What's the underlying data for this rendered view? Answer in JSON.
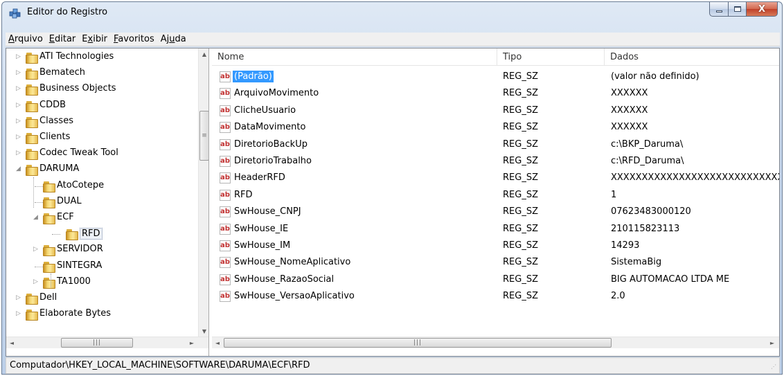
{
  "window": {
    "title": "Editor do Registro",
    "minimize_label": "",
    "maximize_label": "",
    "close_label": "X",
    "colors": {
      "selection": "#3399ff",
      "ab_icon": "#c03030"
    }
  },
  "menu": [
    {
      "pre": "",
      "key": "A",
      "post": "rquivo"
    },
    {
      "pre": "",
      "key": "E",
      "post": "ditar"
    },
    {
      "pre": "E",
      "key": "x",
      "post": "ibir"
    },
    {
      "pre": "",
      "key": "F",
      "post": "avoritos"
    },
    {
      "pre": "Aj",
      "key": "u",
      "post": "da"
    }
  ],
  "tree": {
    "items": [
      {
        "label": "ATI Technologies"
      },
      {
        "label": "Bematech"
      },
      {
        "label": "Business Objects"
      },
      {
        "label": "CDDB"
      },
      {
        "label": "Classes"
      },
      {
        "label": "Clients"
      },
      {
        "label": "Codec Tweak Tool"
      },
      {
        "label": "DARUMA"
      },
      {
        "label": "AtoCotepe"
      },
      {
        "label": "DUAL"
      },
      {
        "label": "ECF"
      },
      {
        "label": "RFD"
      },
      {
        "label": "SERVIDOR"
      },
      {
        "label": "SINTEGRA"
      },
      {
        "label": "TA1000"
      },
      {
        "label": "Dell"
      },
      {
        "label": "Elaborate Bytes"
      }
    ],
    "selected": "RFD"
  },
  "list": {
    "columns": {
      "name": "Nome",
      "type": "Tipo",
      "data": "Dados"
    },
    "rows": [
      {
        "name": "(Padrão)",
        "type": "REG_SZ",
        "data": "(valor não definido)"
      },
      {
        "name": "ArquivoMovimento",
        "type": "REG_SZ",
        "data": "XXXXXX"
      },
      {
        "name": "ClicheUsuario",
        "type": "REG_SZ",
        "data": "XXXXXX"
      },
      {
        "name": "DataMovimento",
        "type": "REG_SZ",
        "data": "XXXXXX"
      },
      {
        "name": "DiretorioBackUp",
        "type": "REG_SZ",
        "data": "c:\\BKP_Daruma\\"
      },
      {
        "name": "DiretorioTrabalho",
        "type": "REG_SZ",
        "data": "c:\\RFD_Daruma\\"
      },
      {
        "name": "HeaderRFD",
        "type": "REG_SZ",
        "data": "XXXXXXXXXXXXXXXXXXXXXXXXXXXX"
      },
      {
        "name": "RFD",
        "type": "REG_SZ",
        "data": "1"
      },
      {
        "name": "SwHouse_CNPJ",
        "type": "REG_SZ",
        "data": "07623483000120"
      },
      {
        "name": "SwHouse_IE",
        "type": "REG_SZ",
        "data": "210115823113"
      },
      {
        "name": "SwHouse_IM",
        "type": "REG_SZ",
        "data": "14293"
      },
      {
        "name": "SwHouse_NomeAplicativo",
        "type": "REG_SZ",
        "data": "SistemaBig"
      },
      {
        "name": "SwHouse_RazaoSocial",
        "type": "REG_SZ",
        "data": "BIG AUTOMACAO LTDA ME"
      },
      {
        "name": "SwHouse_VersaoAplicativo",
        "type": "REG_SZ",
        "data": "2.0"
      }
    ],
    "icon": "ab"
  },
  "statusbar": {
    "path": "Computador\\HKEY_LOCAL_MACHINE\\SOFTWARE\\DARUMA\\ECF\\RFD"
  },
  "icons": [
    "registry-editor-icon",
    "folder-icon",
    "string-value-icon",
    "expand-arrow-icon",
    "collapse-arrow-icon",
    "scroll-up-icon",
    "scroll-down-icon",
    "scroll-left-icon",
    "scroll-right-icon",
    "resize-grip-icon"
  ]
}
